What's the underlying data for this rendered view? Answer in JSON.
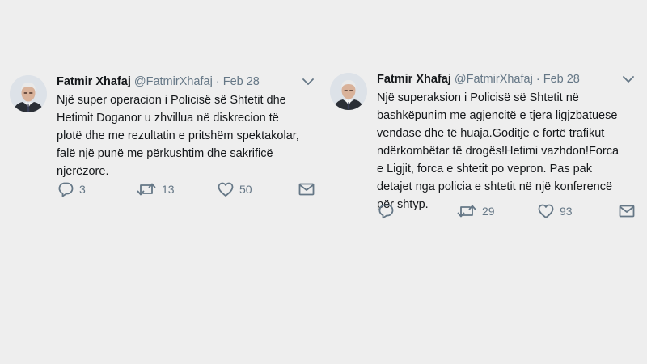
{
  "tweets": [
    {
      "author": {
        "name": "Fatmir Xhafaj",
        "handle": "@FatmirXhafaj",
        "avatar": "avatar-photo"
      },
      "separator": "·",
      "date": "Feb 28",
      "text": "Një super operacion i Policisë së Shtetit dhe\nHetimit Doganor u zhvillua në diskrecion të\nplotë dhe me rezultatin e pritshëm spektakolar,\nfalë një punë me përkushtim dhe sakrificë\nnjerëzore.",
      "actions": {
        "replies": "3",
        "retweets": "13",
        "likes": "50"
      },
      "icons": {
        "reply": "reply-icon",
        "retweet": "retweet-icon",
        "like": "heart-icon",
        "dm": "envelope-icon",
        "menu": "chevron-down-icon"
      }
    },
    {
      "author": {
        "name": "Fatmir Xhafaj",
        "handle": "@FatmirXhafaj",
        "avatar": "avatar-photo"
      },
      "separator": "·",
      "date": "Feb 28",
      "text": "Një superaksion i Policisë së Shtetit në\nbashkëpunim me agjencitë e tjera ligjzbatuese\nvendase dhe të huaja.Goditje e fortë trafikut\nndërkombëtar të drogës!Hetimi vazhdon!Forca\ne Ligjit, forca e shtetit po vepron. Pas pak\ndetajet nga policia e shtetit në një konferencë\npër shtyp.",
      "actions": {
        "replies": "",
        "retweets": "29",
        "likes": "93"
      },
      "icons": {
        "reply": "reply-icon",
        "retweet": "retweet-icon",
        "like": "heart-icon",
        "dm": "envelope-icon",
        "menu": "chevron-down-icon"
      }
    }
  ],
  "colors": {
    "background": "#eeeeee",
    "text": "#14171a",
    "secondary": "#657786"
  }
}
